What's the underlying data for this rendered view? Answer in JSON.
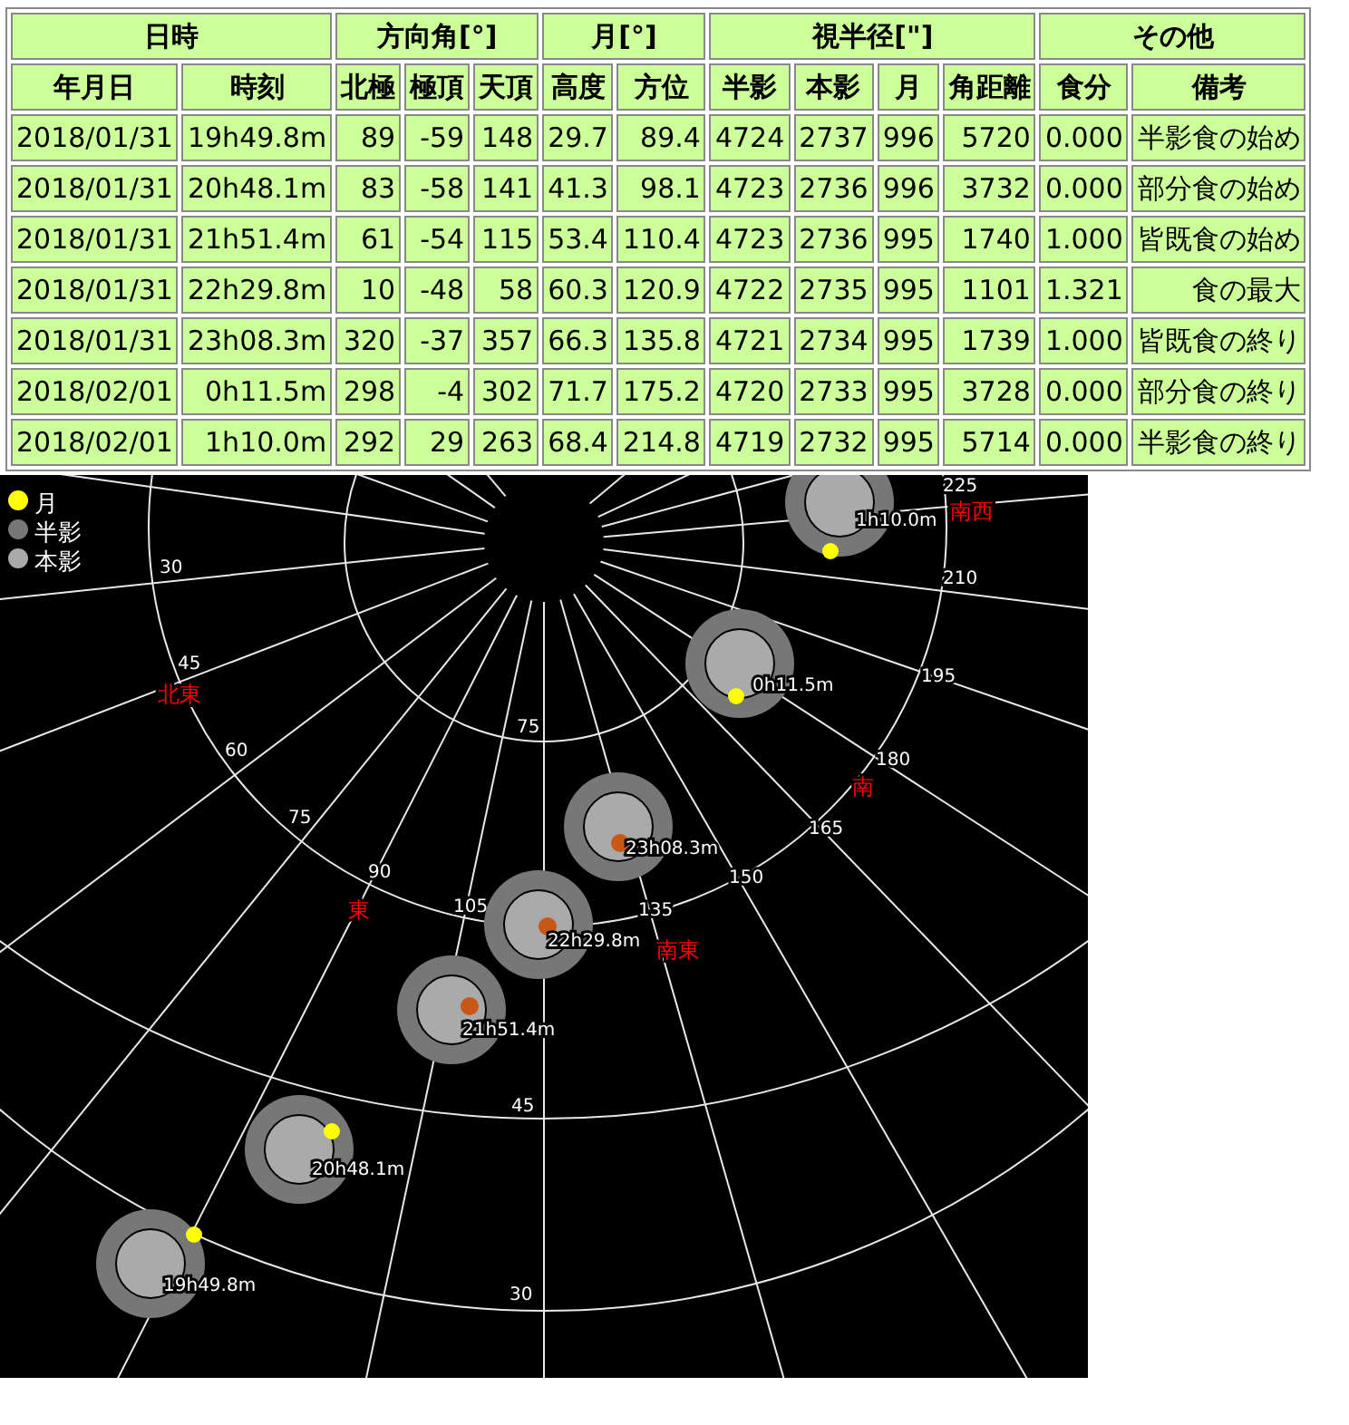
{
  "table": {
    "column_groups": [
      {
        "label": "日時",
        "columns": [
          "年月日",
          "時刻"
        ]
      },
      {
        "label": "方向角[°]",
        "columns": [
          "北極",
          "極頂",
          "天頂"
        ]
      },
      {
        "label": "月[°]",
        "columns": [
          "高度",
          "方位"
        ]
      },
      {
        "label": "視半径[\"]",
        "columns": [
          "半影",
          "本影",
          "月",
          "角距離"
        ]
      },
      {
        "label": "その他",
        "columns": [
          "食分",
          "備考"
        ]
      }
    ],
    "rows": [
      [
        "2018/01/31",
        "19h49.8m",
        "89",
        "-59",
        "148",
        "29.7",
        "89.4",
        "4724",
        "2737",
        "996",
        "5720",
        "0.000",
        "半影食の始め"
      ],
      [
        "2018/01/31",
        "20h48.1m",
        "83",
        "-58",
        "141",
        "41.3",
        "98.1",
        "4723",
        "2736",
        "996",
        "3732",
        "0.000",
        "部分食の始め"
      ],
      [
        "2018/01/31",
        "21h51.4m",
        "61",
        "-54",
        "115",
        "53.4",
        "110.4",
        "4723",
        "2736",
        "995",
        "1740",
        "1.000",
        "皆既食の始め"
      ],
      [
        "2018/01/31",
        "22h29.8m",
        "10",
        "-48",
        "58",
        "60.3",
        "120.9",
        "4722",
        "2735",
        "995",
        "1101",
        "1.321",
        "食の最大"
      ],
      [
        "2018/01/31",
        "23h08.3m",
        "320",
        "-37",
        "357",
        "66.3",
        "135.8",
        "4721",
        "2734",
        "995",
        "1739",
        "1.000",
        "皆既食の終り"
      ],
      [
        "2018/02/01",
        "0h11.5m",
        "298",
        "-4",
        "302",
        "71.7",
        "175.2",
        "4720",
        "2733",
        "995",
        "3728",
        "0.000",
        "部分食の終り"
      ],
      [
        "2018/02/01",
        "1h10.0m",
        "292",
        "29",
        "263",
        "68.4",
        "214.8",
        "4719",
        "2732",
        "995",
        "5714",
        "0.000",
        "半影食の終り"
      ]
    ]
  },
  "sky_map": {
    "legend": [
      {
        "label": "月",
        "kind": "moon"
      },
      {
        "label": "半影",
        "kind": "penumbra"
      },
      {
        "label": "本影",
        "kind": "umbra"
      }
    ],
    "altitude_labels": [
      "75",
      "45",
      "30"
    ],
    "azimuth_labels": [
      "30",
      "45",
      "60",
      "75",
      "90",
      "105",
      "135",
      "150",
      "165",
      "180",
      "195",
      "210",
      "225"
    ],
    "directions": [
      "北東",
      "東",
      "南東",
      "南",
      "南西"
    ],
    "positions": [
      {
        "time": "19h49.8m",
        "eclipsed": false
      },
      {
        "time": "20h48.1m",
        "eclipsed": false
      },
      {
        "time": "21h51.4m",
        "eclipsed": true
      },
      {
        "time": "22h29.8m",
        "eclipsed": true
      },
      {
        "time": "23h08.3m",
        "eclipsed": true
      },
      {
        "time": "0h11.5m",
        "eclipsed": false
      },
      {
        "time": "1h10.0m",
        "eclipsed": false
      }
    ]
  }
}
